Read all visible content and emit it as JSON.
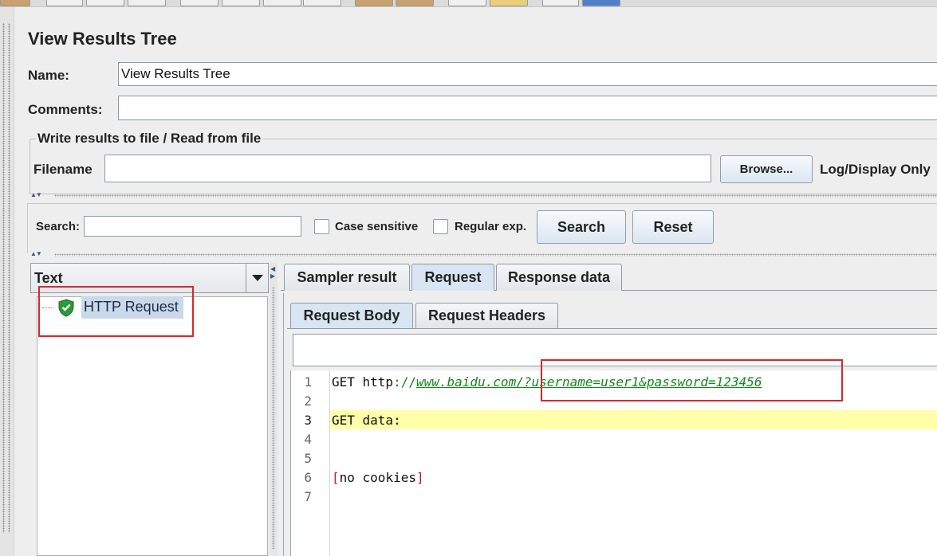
{
  "panel_title": "View Results Tree",
  "form": {
    "name_label": "Name:",
    "name_value": "View Results Tree",
    "comments_label": "Comments:",
    "comments_value": ""
  },
  "file_group": {
    "title": "Write results to file / Read from file",
    "filename_label": "Filename",
    "filename_value": "",
    "browse_label": "Browse...",
    "log_display_label": "Log/Display Only"
  },
  "search": {
    "label": "Search:",
    "value": "",
    "case_sensitive_label": "Case sensitive",
    "case_sensitive_checked": false,
    "regex_label": "Regular exp.",
    "regex_checked": false,
    "search_button": "Search",
    "reset_button": "Reset"
  },
  "results": {
    "renderer_selected": "Text",
    "tree_items": [
      {
        "label": "HTTP Request",
        "status": "success",
        "icon": "shield-check-icon"
      }
    ]
  },
  "tabs": {
    "main": [
      "Sampler result",
      "Request",
      "Response data"
    ],
    "main_active": "Request",
    "sub": [
      "Request Body",
      "Request Headers"
    ],
    "sub_active": "Request Body"
  },
  "editor": {
    "line_numbers": [
      "1",
      "2",
      "3",
      "4",
      "5",
      "6",
      "7"
    ],
    "line1_prefix": "GET http",
    "line1_sep": "://",
    "line1_url": "www.baidu.com/?username=user1&password=123456",
    "line3": "GET data:",
    "line6_open": "[",
    "line6_text": "no cookies",
    "line6_close": "]",
    "highlighted_line": "3"
  },
  "colors": {
    "annotation_red": "#d9262c",
    "url_green": "#12881a",
    "highlight_yellow": "#ffffaa",
    "selection_blue": "#c9d9ea"
  }
}
